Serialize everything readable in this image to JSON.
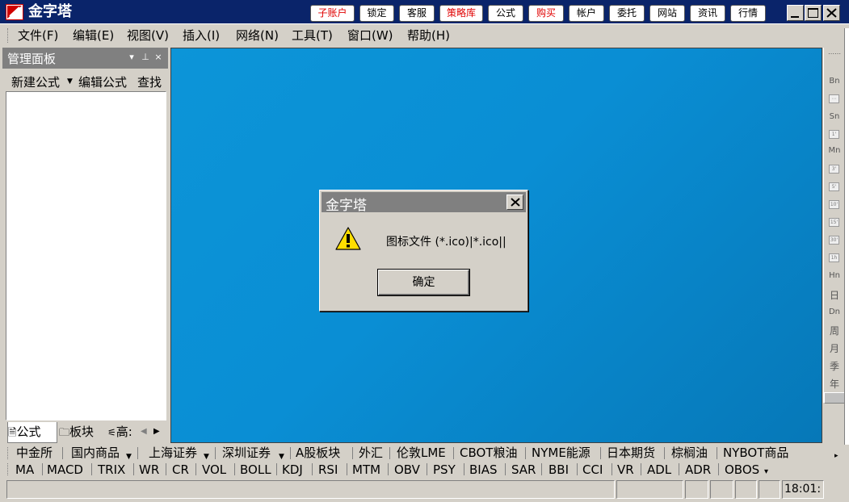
{
  "app": {
    "title": "金字塔"
  },
  "toolbar_buttons": [
    {
      "label": "子账户",
      "color": "#e00000"
    },
    {
      "label": "锁定",
      "color": "#000000"
    },
    {
      "label": "客服",
      "color": "#000000"
    },
    {
      "label": "策略库",
      "color": "#e00000"
    },
    {
      "label": "公式",
      "color": "#000000"
    },
    {
      "label": "购买",
      "color": "#e00000"
    },
    {
      "label": "帐户",
      "color": "#000000"
    },
    {
      "label": "委托",
      "color": "#000000"
    },
    {
      "label": "网站",
      "color": "#000000"
    },
    {
      "label": "资讯",
      "color": "#000000"
    },
    {
      "label": "行情",
      "color": "#000000"
    }
  ],
  "menu": [
    "文件(F)",
    "编辑(E)",
    "视图(V)",
    "插入(I)",
    "网络(N)",
    "工具(T)",
    "窗口(W)",
    "帮助(H)"
  ],
  "panel": {
    "title": "管理面板",
    "pin_glyph": "▾ ⊥ ×",
    "toolbar": {
      "new_formula": "新建公式",
      "edit_formula": "编辑公式",
      "find": "查找"
    },
    "tabs": {
      "formula": "公式",
      "sector": "板块",
      "advanced": "高:"
    }
  },
  "right_bar": {
    "labels": [
      "Bn",
      "Sn",
      "Mn",
      "Hn",
      "日",
      "Dn",
      "周",
      "月",
      "季",
      "年"
    ],
    "boxes": [
      "1'",
      "3'",
      "5'",
      "10'",
      "15'",
      "30'",
      "1h"
    ]
  },
  "dialog": {
    "title": "金字塔",
    "message": "图标文件 (*.ico)|*.ico||",
    "ok_label": "确定"
  },
  "market_tabs": [
    "中金所",
    "国内商品",
    "上海证券",
    "深圳证券",
    "A股板块",
    "外汇",
    "伦敦LME",
    "CBOT粮油",
    "NYME能源",
    "日本期货",
    "棕榈油",
    "NYBOT商品"
  ],
  "indicators": [
    "MA",
    "MACD",
    "TRIX",
    "WR",
    "CR",
    "VOL",
    "BOLL",
    "KDJ",
    "RSI",
    "MTM",
    "OBV",
    "PSY",
    "BIAS",
    "SAR",
    "BBI",
    "CCI",
    "VR",
    "ADL",
    "ADR",
    "OBOS"
  ],
  "status": {
    "time": "18:01:"
  }
}
